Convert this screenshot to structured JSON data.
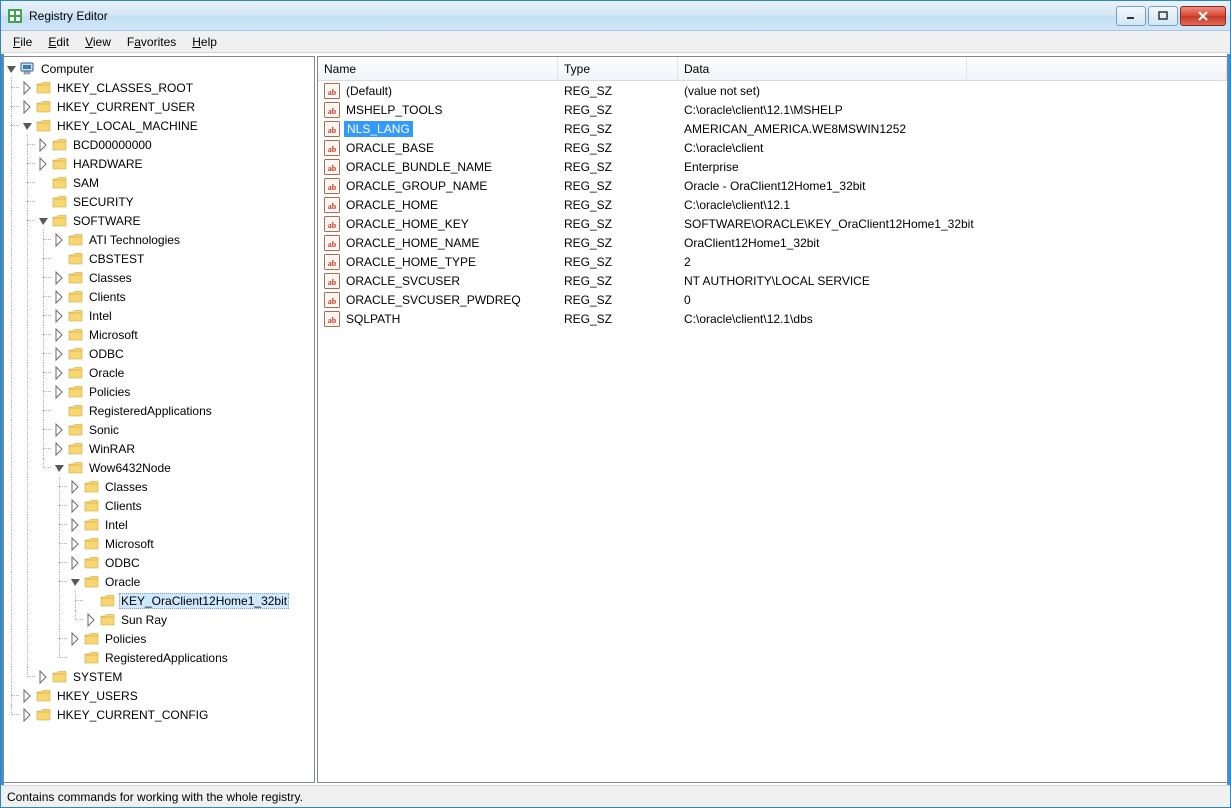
{
  "window": {
    "title": "Registry Editor"
  },
  "menu": {
    "file": "File",
    "edit": "Edit",
    "view": "View",
    "favorites": "Favorites",
    "help": "Help"
  },
  "columns": {
    "name": "Name",
    "type": "Type",
    "data": "Data"
  },
  "tree": [
    {
      "depth": 0,
      "exp": "open",
      "icon": "computer",
      "label": "Computer"
    },
    {
      "depth": 1,
      "exp": "closed",
      "icon": "folder",
      "label": "HKEY_CLASSES_ROOT"
    },
    {
      "depth": 1,
      "exp": "closed",
      "icon": "folder",
      "label": "HKEY_CURRENT_USER"
    },
    {
      "depth": 1,
      "exp": "open",
      "icon": "folder",
      "label": "HKEY_LOCAL_MACHINE"
    },
    {
      "depth": 2,
      "exp": "closed",
      "icon": "folder",
      "label": "BCD00000000"
    },
    {
      "depth": 2,
      "exp": "closed",
      "icon": "folder",
      "label": "HARDWARE"
    },
    {
      "depth": 2,
      "exp": "none",
      "icon": "folder",
      "label": "SAM"
    },
    {
      "depth": 2,
      "exp": "none",
      "icon": "folder",
      "label": "SECURITY"
    },
    {
      "depth": 2,
      "exp": "open",
      "icon": "folder",
      "label": "SOFTWARE"
    },
    {
      "depth": 3,
      "exp": "closed",
      "icon": "folder",
      "label": "ATI Technologies"
    },
    {
      "depth": 3,
      "exp": "none",
      "icon": "folder",
      "label": "CBSTEST"
    },
    {
      "depth": 3,
      "exp": "closed",
      "icon": "folder",
      "label": "Classes"
    },
    {
      "depth": 3,
      "exp": "closed",
      "icon": "folder",
      "label": "Clients"
    },
    {
      "depth": 3,
      "exp": "closed",
      "icon": "folder",
      "label": "Intel"
    },
    {
      "depth": 3,
      "exp": "closed",
      "icon": "folder",
      "label": "Microsoft"
    },
    {
      "depth": 3,
      "exp": "closed",
      "icon": "folder",
      "label": "ODBC"
    },
    {
      "depth": 3,
      "exp": "closed",
      "icon": "folder",
      "label": "Oracle"
    },
    {
      "depth": 3,
      "exp": "closed",
      "icon": "folder",
      "label": "Policies"
    },
    {
      "depth": 3,
      "exp": "none",
      "icon": "folder",
      "label": "RegisteredApplications"
    },
    {
      "depth": 3,
      "exp": "closed",
      "icon": "folder",
      "label": "Sonic"
    },
    {
      "depth": 3,
      "exp": "closed",
      "icon": "folder",
      "label": "WinRAR"
    },
    {
      "depth": 3,
      "exp": "open",
      "icon": "folder",
      "label": "Wow6432Node"
    },
    {
      "depth": 4,
      "exp": "closed",
      "icon": "folder",
      "label": "Classes"
    },
    {
      "depth": 4,
      "exp": "closed",
      "icon": "folder",
      "label": "Clients"
    },
    {
      "depth": 4,
      "exp": "closed",
      "icon": "folder",
      "label": "Intel"
    },
    {
      "depth": 4,
      "exp": "closed",
      "icon": "folder",
      "label": "Microsoft"
    },
    {
      "depth": 4,
      "exp": "closed",
      "icon": "folder",
      "label": "ODBC"
    },
    {
      "depth": 4,
      "exp": "open",
      "icon": "folder",
      "label": "Oracle"
    },
    {
      "depth": 5,
      "exp": "none",
      "icon": "folder",
      "label": "KEY_OraClient12Home1_32bit",
      "sel": true
    },
    {
      "depth": 5,
      "exp": "closed",
      "icon": "folder",
      "label": "Sun Ray"
    },
    {
      "depth": 4,
      "exp": "closed",
      "icon": "folder",
      "label": "Policies"
    },
    {
      "depth": 4,
      "exp": "none",
      "icon": "folder",
      "label": "RegisteredApplications"
    },
    {
      "depth": 2,
      "exp": "closed",
      "icon": "folder",
      "label": "SYSTEM"
    },
    {
      "depth": 1,
      "exp": "closed",
      "icon": "folder",
      "label": "HKEY_USERS"
    },
    {
      "depth": 1,
      "exp": "closed",
      "icon": "folder",
      "label": "HKEY_CURRENT_CONFIG"
    }
  ],
  "values": [
    {
      "name": "(Default)",
      "type": "REG_SZ",
      "data": "(value not set)"
    },
    {
      "name": "MSHELP_TOOLS",
      "type": "REG_SZ",
      "data": "C:\\oracle\\client\\12.1\\MSHELP"
    },
    {
      "name": "NLS_LANG",
      "type": "REG_SZ",
      "data": "AMERICAN_AMERICA.WE8MSWIN1252",
      "sel": true
    },
    {
      "name": "ORACLE_BASE",
      "type": "REG_SZ",
      "data": "C:\\oracle\\client"
    },
    {
      "name": "ORACLE_BUNDLE_NAME",
      "type": "REG_SZ",
      "data": "Enterprise"
    },
    {
      "name": "ORACLE_GROUP_NAME",
      "type": "REG_SZ",
      "data": "Oracle - OraClient12Home1_32bit"
    },
    {
      "name": "ORACLE_HOME",
      "type": "REG_SZ",
      "data": "C:\\oracle\\client\\12.1"
    },
    {
      "name": "ORACLE_HOME_KEY",
      "type": "REG_SZ",
      "data": "SOFTWARE\\ORACLE\\KEY_OraClient12Home1_32bit"
    },
    {
      "name": "ORACLE_HOME_NAME",
      "type": "REG_SZ",
      "data": "OraClient12Home1_32bit"
    },
    {
      "name": "ORACLE_HOME_TYPE",
      "type": "REG_SZ",
      "data": "2"
    },
    {
      "name": "ORACLE_SVCUSER",
      "type": "REG_SZ",
      "data": "NT AUTHORITY\\LOCAL SERVICE"
    },
    {
      "name": "ORACLE_SVCUSER_PWDREQ",
      "type": "REG_SZ",
      "data": "0"
    },
    {
      "name": "SQLPATH",
      "type": "REG_SZ",
      "data": "C:\\oracle\\client\\12.1\\dbs"
    }
  ],
  "statusbar": "Contains commands for working with the whole registry."
}
